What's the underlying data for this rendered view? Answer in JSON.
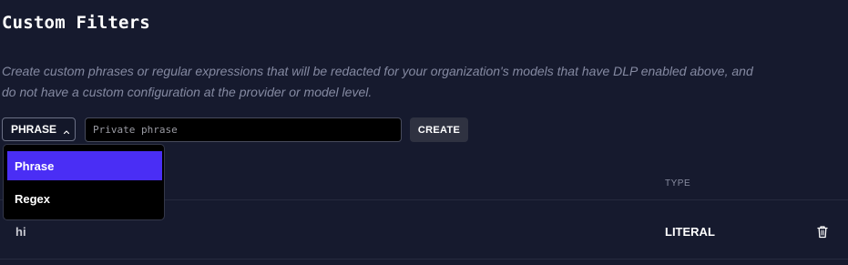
{
  "header": {
    "title": "Custom Filters",
    "description_line1": "Create custom phrases or regular expressions that will be redacted for your organization's models that have DLP enabled above, and",
    "description_line2": "do not have a custom configuration at the provider or model level."
  },
  "form": {
    "type_select_label": "PHRASE",
    "input_placeholder": "Private phrase",
    "input_value": "",
    "create_label": "CREATE"
  },
  "dropdown": {
    "options": [
      {
        "label": "Phrase",
        "selected": true
      },
      {
        "label": "Regex",
        "selected": false
      }
    ]
  },
  "table": {
    "columns": [
      "TYPE"
    ],
    "rows": [
      {
        "value": "hi",
        "type": "LITERAL"
      }
    ]
  },
  "icons": {
    "select_chevron": "chevron-up-icon",
    "row_delete": "trash-icon"
  },
  "colors": {
    "background": "#161a2e",
    "accent": "#4a2ef5",
    "muted_text": "#858aa2"
  }
}
